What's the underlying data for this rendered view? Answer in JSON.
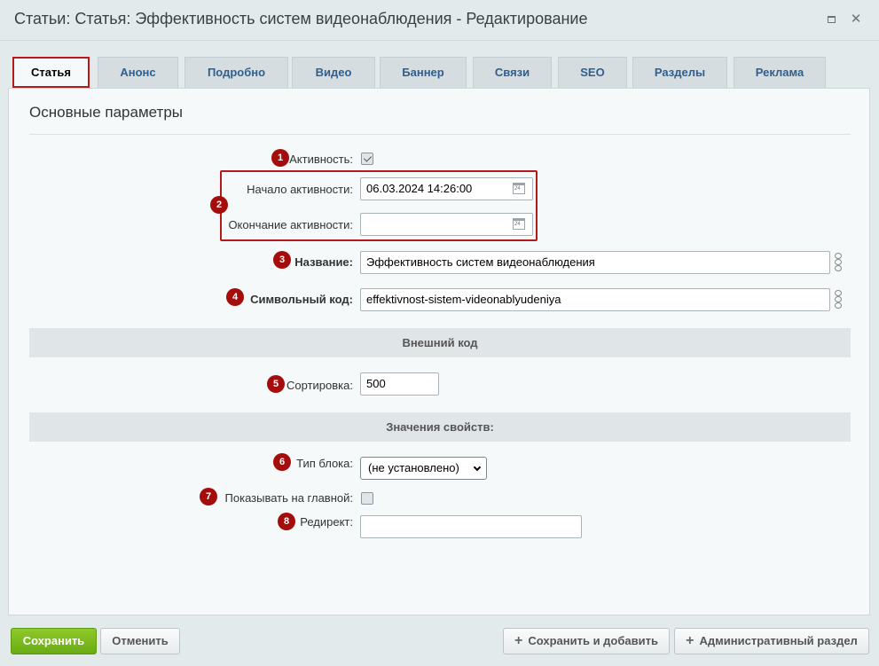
{
  "window": {
    "title": "Статьи: Статья: Эффективность систем видеонаблюдения - Редактирование",
    "maximize_icon": "maximize-icon",
    "close_icon": "close-icon",
    "close_glyph": "✕"
  },
  "tabs": [
    {
      "label": "Статья",
      "active": true
    },
    {
      "label": "Анонс"
    },
    {
      "label": "Подробно"
    },
    {
      "label": "Видео"
    },
    {
      "label": "Баннер"
    },
    {
      "label": "Связи"
    },
    {
      "label": "SEO"
    },
    {
      "label": "Разделы"
    },
    {
      "label": "Реклама"
    }
  ],
  "section": {
    "title": "Основные параметры"
  },
  "badges": [
    "1",
    "2",
    "3",
    "4",
    "5",
    "6",
    "7",
    "8"
  ],
  "fields": {
    "active": {
      "label": "Активность:",
      "checked": true
    },
    "active_from": {
      "label": "Начало активности:",
      "value": "06.03.2024 14:26:00",
      "calendar_day": "24"
    },
    "active_to": {
      "label": "Окончание активности:",
      "value": "",
      "calendar_day": "24"
    },
    "name": {
      "label": "Название:",
      "value": "Эффективность систем видеонаблюдения"
    },
    "code": {
      "label": "Символьный код:",
      "value": "effektivnost-sistem-videonablyudeniya"
    },
    "sort": {
      "label": "Сортировка:",
      "value": "500"
    },
    "block_type": {
      "label": "Тип блока:",
      "value": "(не установлено)"
    },
    "show_on_main": {
      "label": "Показывать на главной:",
      "checked": false
    },
    "redirect": {
      "label": "Редирект:",
      "value": ""
    }
  },
  "bars": {
    "external_code": "Внешний код",
    "properties": "Значения свойств:"
  },
  "buttons": {
    "save": "Сохранить",
    "cancel": "Отменить",
    "save_and_add": "Сохранить и добавить",
    "admin_section": "Административный раздел"
  },
  "colors": {
    "accent_red": "#b51a1a",
    "badge_red": "#a50d0d",
    "save_green": "#6aab14",
    "tab_text": "#2f5f8f"
  }
}
